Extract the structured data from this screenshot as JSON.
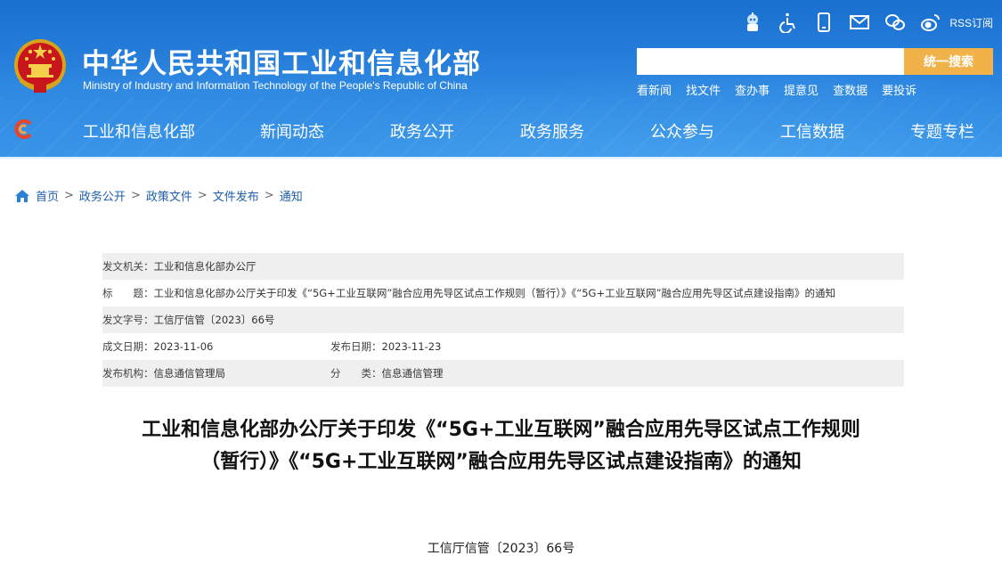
{
  "header": {
    "site_name_cn": "中华人民共和国工业和信息化部",
    "site_name_en": "Ministry of Industry and Information Technology of the People's Republic of China",
    "top_icons": [
      "robot-icon",
      "accessibility-icon",
      "mobile-icon",
      "mail-icon",
      "wechat-icon",
      "weibo-icon"
    ],
    "rss_label": "RSS订阅",
    "search_placeholder": "",
    "search_button": "统一搜索",
    "quick_links": [
      "看新闻",
      "找文件",
      "查办事",
      "提意见",
      "查数据",
      "要投诉"
    ],
    "accent_color": "#f2b24a",
    "header_color": "#2c86e0"
  },
  "nav": {
    "items": [
      "工业和信息化部",
      "新闻动态",
      "政务公开",
      "政务服务",
      "公众参与",
      "工信数据",
      "专题专栏"
    ]
  },
  "breadcrumb": {
    "items": [
      "首页",
      "政务公开",
      "政策文件",
      "文件发布",
      "通知"
    ],
    "separator": ">"
  },
  "meta": {
    "issuer_label": "发文机关：",
    "issuer": "工业和信息化部办公厅",
    "title_label": "标　　题：",
    "title": "工业和信息化部办公厅关于印发《“5G+工业互联网”融合应用先导区试点工作规则（暂行）》《“5G+工业互联网”融合应用先导区试点建设指南》的通知",
    "docno_label": "发文字号：",
    "docno": "工信厅信管〔2023〕66号",
    "created_label": "成文日期：",
    "created": "2023-11-06",
    "published_label": "发布日期：",
    "published": "2023-11-23",
    "org_label": "发布机构：",
    "org": "信息通信管理局",
    "category_label": "分　　类：",
    "category": "信息通信管理"
  },
  "article": {
    "title_line1": "工业和信息化部办公厅关于印发《“5G+工业互联网”融合应用先导区试点工作规则",
    "title_line2": "（暂行）》《“5G+工业互联网”融合应用先导区试点建设指南》的通知",
    "doc_number": "工信厅信管〔2023〕66号"
  }
}
